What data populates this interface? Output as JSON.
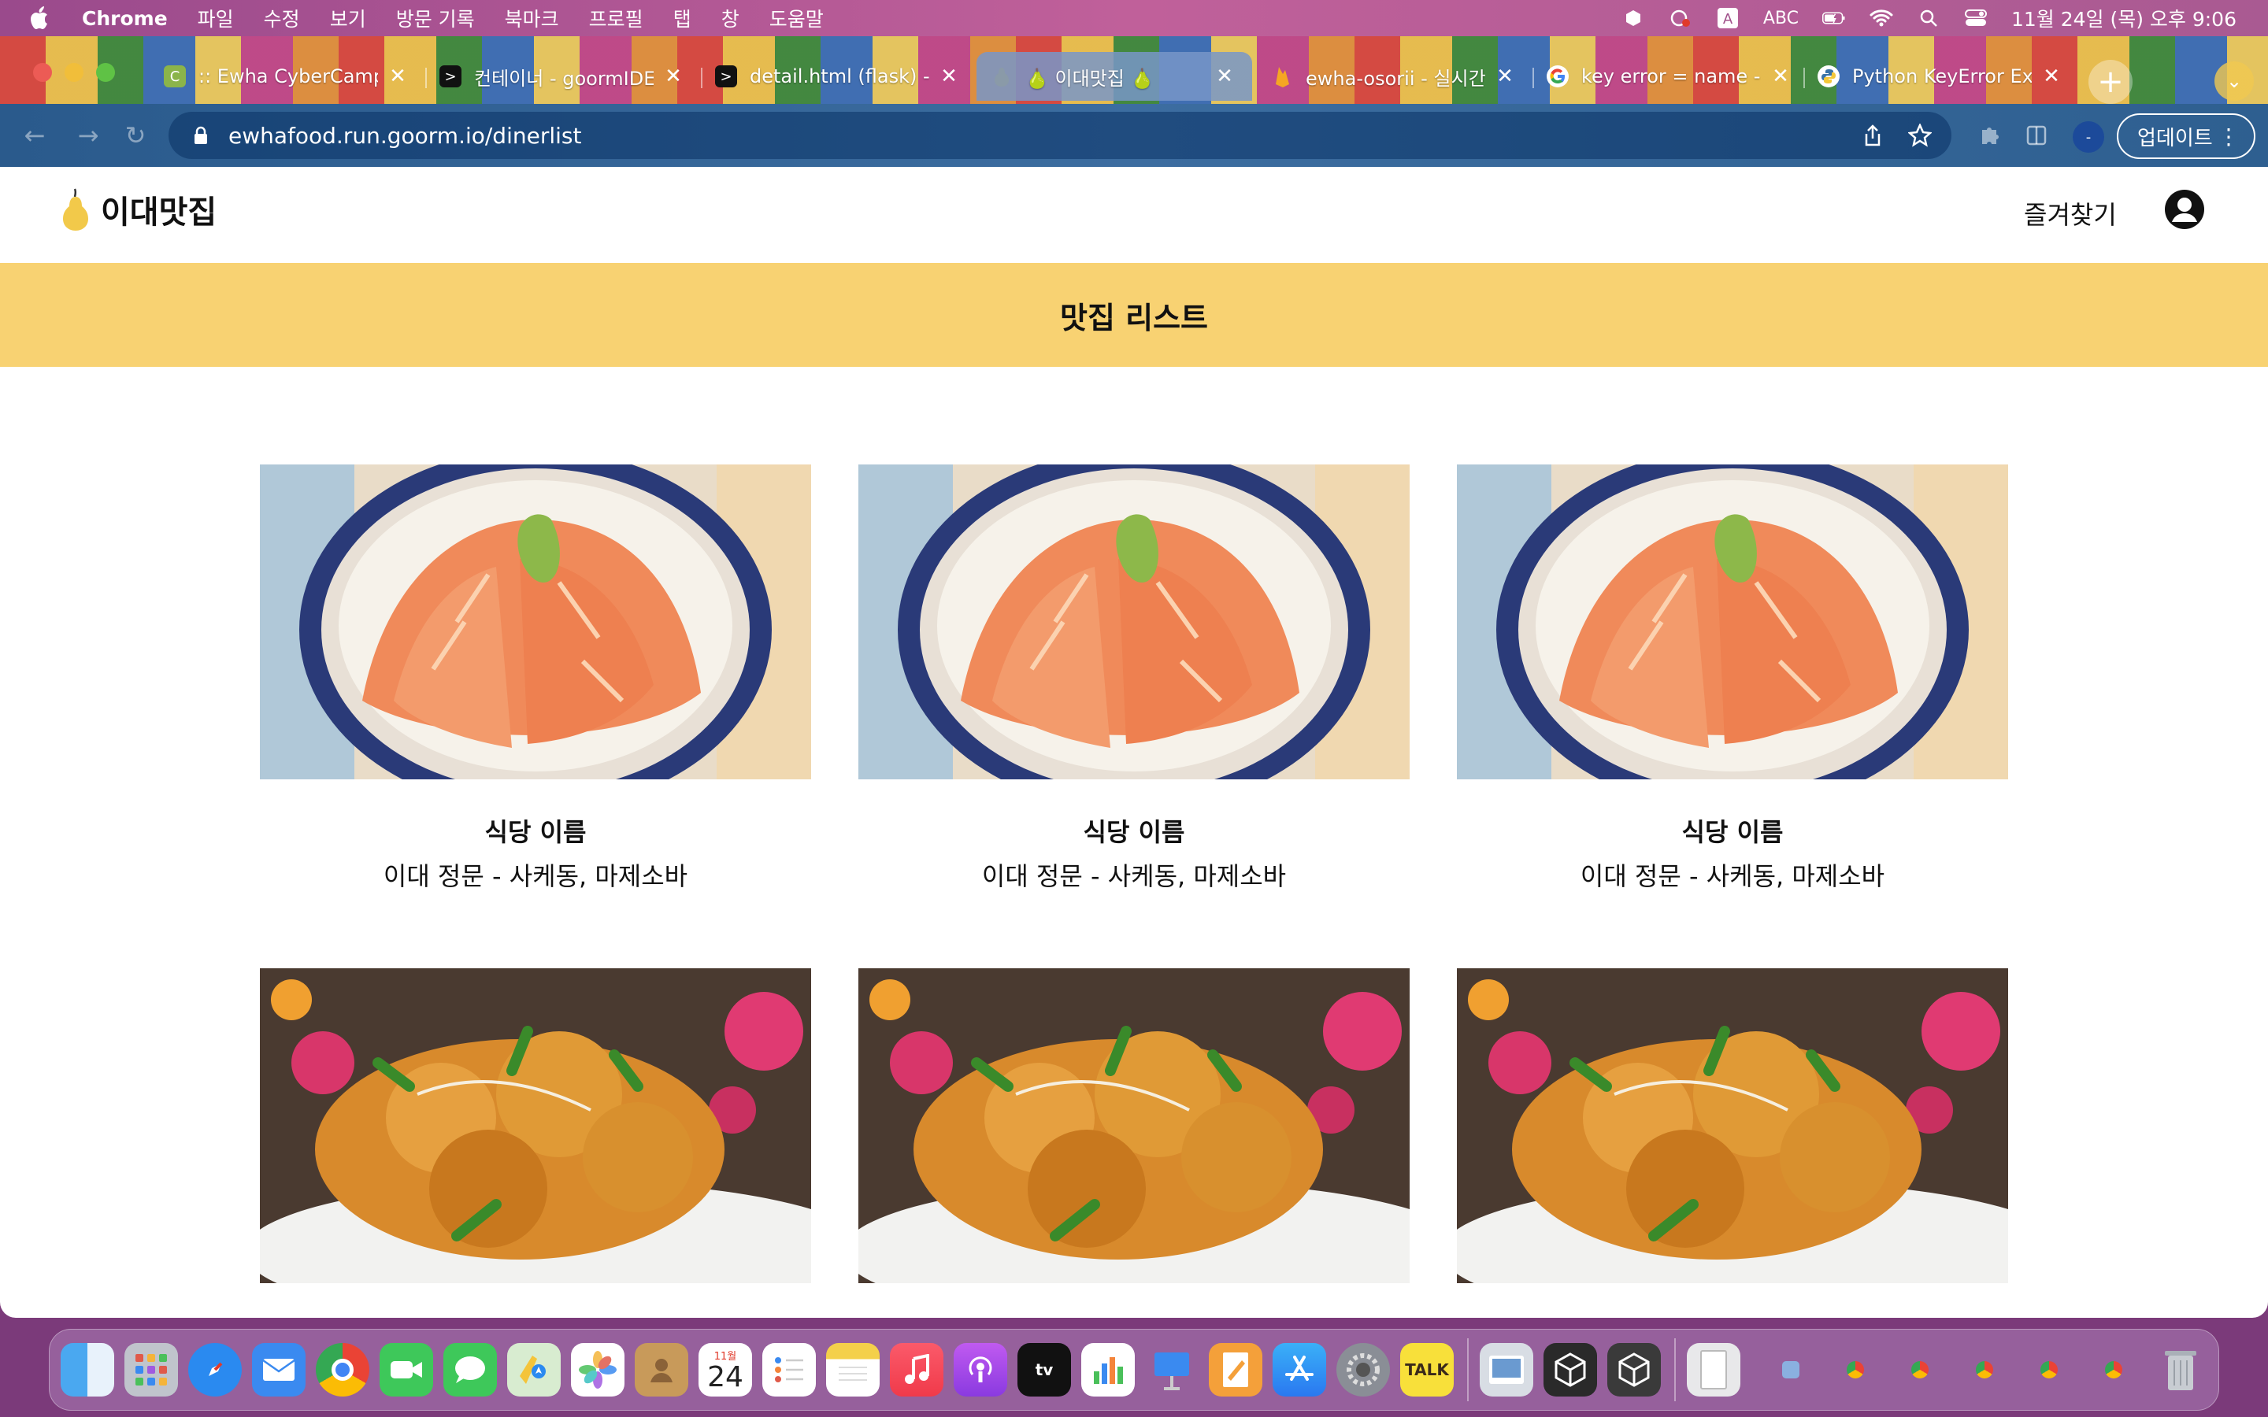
{
  "menubar": {
    "app_name": "Chrome",
    "menus": [
      "파일",
      "수정",
      "보기",
      "방문 기록",
      "북마크",
      "프로필",
      "탭",
      "창",
      "도움말"
    ],
    "input_source": "ABC",
    "clock": "11월 24일 (목) 오후 9:06"
  },
  "tabs": [
    {
      "title": ":: Ewha CyberCamp",
      "icon": "cybercampus-icon"
    },
    {
      "title": "컨테이너 - goormIDE",
      "icon": "terminal-icon"
    },
    {
      "title": "detail.html (flask) -",
      "icon": "terminal-icon"
    },
    {
      "title": "🍐 이대맛집 🍐",
      "icon": "pear-icon",
      "active": true
    },
    {
      "title": "ewha-osorii - 실시간",
      "icon": "firebase-icon"
    },
    {
      "title": "key error = name - G",
      "icon": "google-icon"
    },
    {
      "title": "Python KeyError Ex",
      "icon": "python-icon"
    }
  ],
  "address_bar": {
    "url": "ewhafood.run.goorm.io/dinerlist"
  },
  "toolbar": {
    "profile_initial": "-",
    "update_label": "업데이트"
  },
  "site": {
    "logo_text": "이대맛집",
    "favorites_link": "즐겨찾기",
    "banner_title": "맛집 리스트"
  },
  "restaurants": [
    {
      "name": "식당 이름",
      "description": "이대 정문 - 사케동, 마제소바",
      "photo": "salmon-don"
    },
    {
      "name": "식당 이름",
      "description": "이대 정문 - 사케동, 마제소바",
      "photo": "salmon-don"
    },
    {
      "name": "식당 이름",
      "description": "이대 정문 - 사케동, 마제소바",
      "photo": "salmon-don"
    },
    {
      "name": "",
      "description": "",
      "photo": "fried-pork"
    },
    {
      "name": "",
      "description": "",
      "photo": "fried-pork"
    },
    {
      "name": "",
      "description": "",
      "photo": "fried-pork"
    }
  ],
  "colors": {
    "banner": "#f8d272",
    "menubar": "#b25a92",
    "toolbar": "#3163a0"
  },
  "dock": {
    "apps": [
      "finder-icon",
      "launchpad-icon",
      "safari-icon",
      "mail-icon",
      "chrome-icon",
      "facetime-icon",
      "messages-icon",
      "maps-icon",
      "photos-icon",
      "contacts-icon",
      "calendar-icon",
      "reminders-icon",
      "notes-icon",
      "music-icon",
      "podcasts-icon",
      "tv-icon",
      "numbers-icon",
      "keynote-icon",
      "pages-icon",
      "appstore-icon",
      "settings-icon",
      "kakaotalk-icon"
    ],
    "calendar_month": "11월",
    "calendar_day": "24",
    "tv_label": "tv",
    "kakao_label": "TALK"
  }
}
